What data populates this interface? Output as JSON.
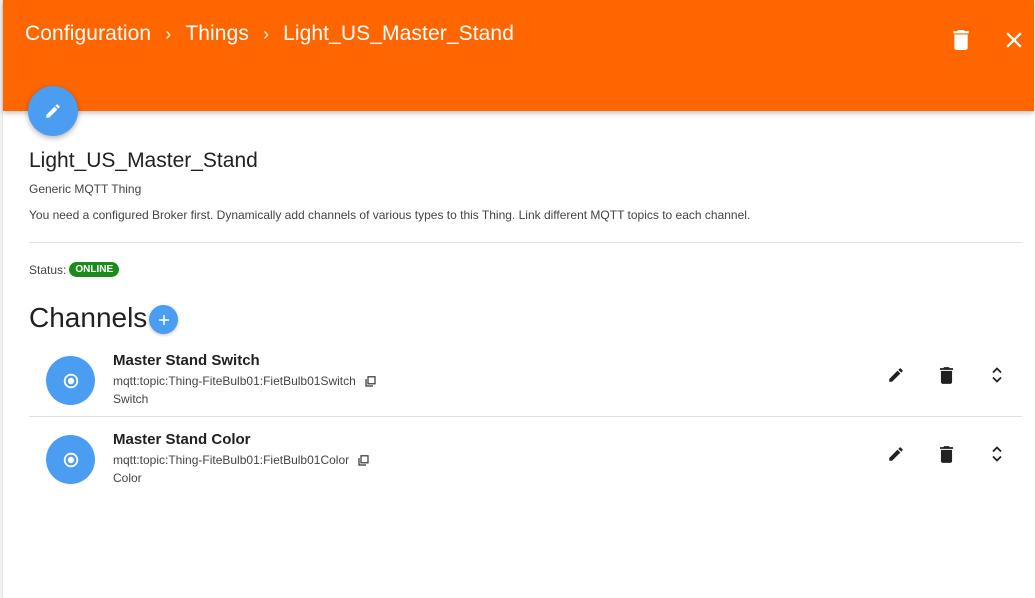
{
  "header": {
    "breadcrumb": [
      "Configuration",
      "Things",
      "Light_US_Master_Stand"
    ],
    "separator": "›",
    "background_color": "#ff6600",
    "delete_icon": "trash-icon",
    "close_icon": "close-icon"
  },
  "thing": {
    "title": "Light_US_Master_Stand",
    "type": "Generic MQTT Thing",
    "description": "You need a configured Broker first. Dynamically add channels of various types to this Thing. Link different MQTT topics to each channel.",
    "status_label": "Status:",
    "status": "ONLINE",
    "status_color": "#1b8c1b",
    "edit_icon": "pencil-icon"
  },
  "channels": {
    "title": "Channels",
    "add_icon": "plus-icon",
    "accent_color": "#4a9df0",
    "items": [
      {
        "label": "Master Stand Switch",
        "uid": "mqtt:topic:Thing-FiteBulb01:FietBulb01Switch",
        "type": "Switch"
      },
      {
        "label": "Master Stand Color",
        "uid": "mqtt:topic:Thing-FiteBulb01:FietBulb01Color",
        "type": "Color"
      }
    ]
  }
}
